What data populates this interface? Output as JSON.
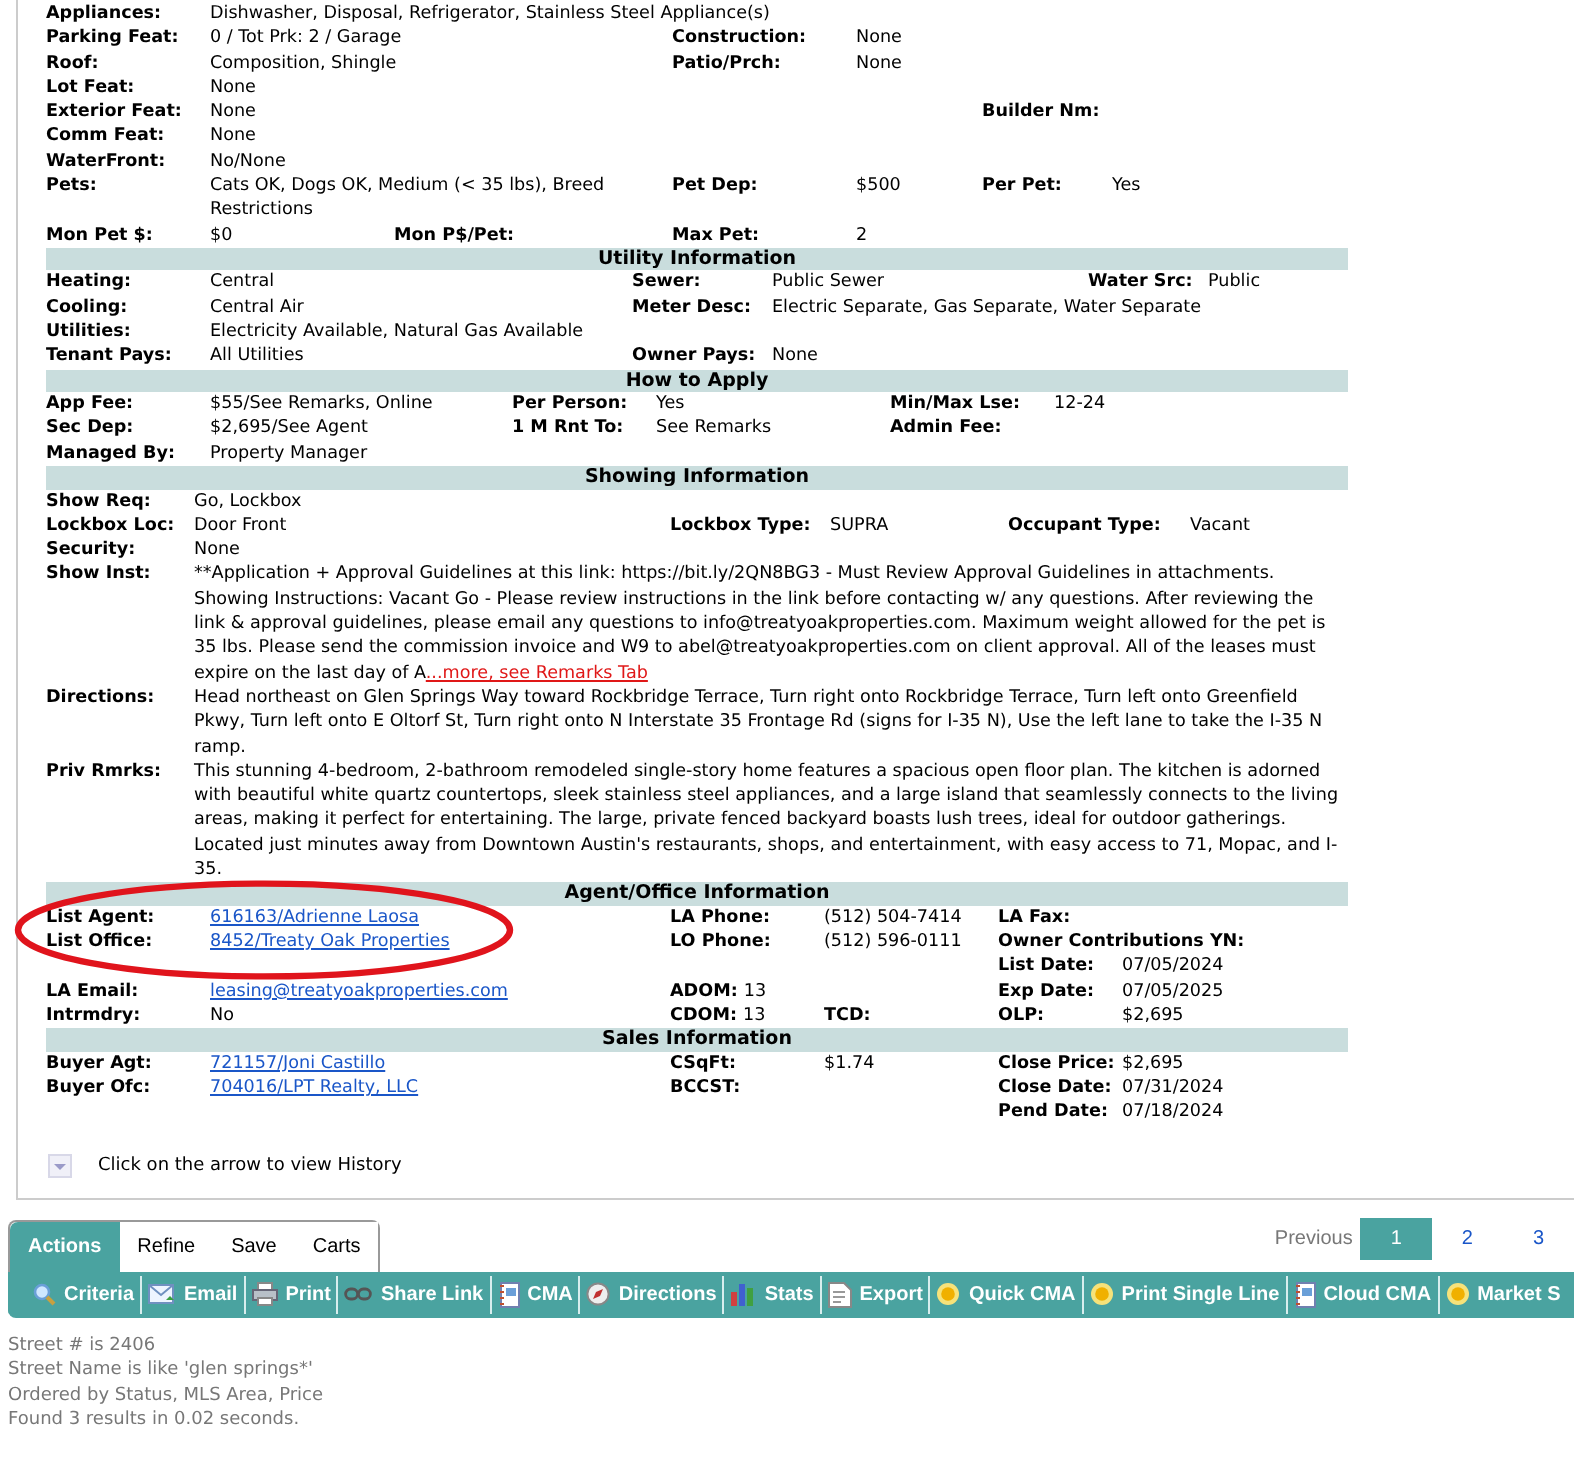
{
  "sections": [
    {
      "rows": [
        [
          {
            "label": "Appliances:",
            "value": "Dishwasher, Disposal, Refrigerator, Stainless Steel Appliance(s)",
            "kind": "text"
          }
        ],
        [
          {
            "label": "Parking Feat:",
            "value": "0 / Tot Prk: 2 / Garage",
            "kind": "text"
          },
          {
            "label": "Construction:",
            "value": "None",
            "kind": "text"
          }
        ],
        [
          {
            "label": "Roof:",
            "value": "Composition, Shingle",
            "kind": "text"
          },
          {
            "label": "Patio/Prch:",
            "value": "None",
            "kind": "text"
          }
        ],
        [
          {
            "label": "Lot Feat:",
            "value": "None",
            "kind": "text"
          }
        ],
        [
          {
            "label": "Exterior Feat:",
            "value": "None",
            "kind": "text"
          },
          "",
          {
            "label": "Builder Nm:",
            "kind": "text"
          }
        ],
        [
          {
            "label": "Comm Feat:",
            "value": "None",
            "kind": "text"
          }
        ],
        [
          {
            "label": "WaterFront:",
            "value": "No/None",
            "kind": "text"
          }
        ],
        [
          {
            "label": "Pets:",
            "value": "Cats OK, Dogs OK, Medium (< 35 lbs), Breed Restrictions",
            "kind": "text"
          },
          {
            "label": "Pet Dep:",
            "value": "$500",
            "kind": "text"
          },
          {
            "label": "Per Pet:",
            "value": "Yes",
            "kind": "text"
          }
        ],
        [
          {
            "label": "Mon Pet $:",
            "value": "$0",
            "extra_label": "Mon P$/Pet:",
            "kind": "text"
          },
          {
            "label": "Max Pet:",
            "value": "2",
            "kind": "text"
          }
        ]
      ]
    },
    {
      "title": "Utility Information",
      "rows": [
        [
          {
            "label": "Heating:",
            "value": "Central",
            "kind": "text"
          },
          {
            "label": "Sewer:",
            "value": "Public Sewer",
            "kind": "text"
          },
          {
            "label": "Water Src:",
            "value": "Public",
            "kind": "text"
          }
        ],
        [
          {
            "label": "Cooling:",
            "value": "Central Air",
            "kind": "text"
          },
          {
            "label": "Meter Desc:",
            "value": "Electric Separate, Gas Separate, Water Separate",
            "kind": "text"
          }
        ],
        [
          {
            "label": "Utilities:",
            "value": "Electricity Available, Natural Gas Available",
            "kind": "text"
          }
        ],
        [
          {
            "label": "Tenant Pays:",
            "value": "All Utilities",
            "kind": "text"
          },
          {
            "label": "Owner Pays:",
            "value": "None",
            "kind": "text"
          }
        ]
      ]
    },
    {
      "title": "How to Apply",
      "rows": [
        [
          {
            "label": "App Fee:",
            "value": "$55/See Remarks, Online",
            "kind": "text"
          },
          {
            "label": "Per Person:",
            "value": "Yes",
            "kind": "text"
          },
          {
            "label": "Min/Max Lse:",
            "value": "12-24",
            "kind": "text"
          }
        ],
        [
          {
            "label": "Sec Dep:",
            "value": "$2,695/See Agent",
            "kind": "text"
          },
          {
            "label": "1 M Rnt To:",
            "value": "See Remarks",
            "kind": "text"
          },
          {
            "label": "Admin Fee:",
            "kind": "text"
          }
        ],
        [
          {
            "label": "Managed By:",
            "value": "Property Manager",
            "kind": "text"
          }
        ]
      ]
    },
    {
      "title": "Showing Information",
      "rows": [
        [
          {
            "label": "Show Req:",
            "value": "Go, Lockbox",
            "kind": "text"
          }
        ],
        [
          {
            "label": "Lockbox Loc:",
            "value": "Door Front",
            "kind": "text"
          },
          {
            "label": "Lockbox Type:",
            "value": "SUPRA",
            "kind": "text"
          },
          {
            "label": "Occupant Type:",
            "value": "Vacant",
            "kind": "text"
          }
        ],
        [
          {
            "label": "Security:",
            "value": "None",
            "kind": "text"
          }
        ],
        [
          {
            "label": "Show Inst:",
            "value": "**Application + Approval Guidelines at this link: https://bit.ly/2QN8BG3 - Must Review Approval Guidelines in attachments. Showing Instructions: Vacant Go - Please review instructions in the link before contacting w/ any questions. After reviewing the link & approval guidelines, please email any questions to info@treatyoakproperties.com. Maximum weight allowed for the pet is 35 lbs. Please send the commission invoice and W9 to abel@treatyoakproperties.com on client approval. All of the leases must expire on the last day of A",
            "more_link": "...more, see Remarks Tab",
            "kind": "text"
          }
        ],
        [
          {
            "label": "Directions:",
            "value": "Head northeast on Glen Springs Way toward Rockbridge Terrace, Turn right onto Rockbridge Terrace, Turn left onto Greenfield Pkwy, Turn left onto E Oltorf St, Turn right onto N Interstate 35 Frontage Rd (signs for I-35 N), Use the left lane to take the I-35 N ramp.",
            "kind": "text"
          }
        ],
        [
          {
            "label": "Priv Rmrks:",
            "value": "This stunning 4-bedroom, 2-bathroom remodeled single-story home features a spacious open floor plan. The kitchen is adorned with beautiful white quartz countertops, sleek stainless steel appliances, and a large island that seamlessly connects to the living areas, making it perfect for entertaining. The large, private fenced backyard boasts lush trees, ideal for outdoor gatherings. Located just minutes away from Downtown Austin's restaurants, shops, and entertainment, with easy access to 71, Mopac, and I-35.",
            "kind": "text"
          }
        ]
      ]
    },
    {
      "title": "Agent/Office Information",
      "rows": [
        [
          {
            "label": "List Agent:",
            "value": "616163/Adrienne Laosa",
            "kind": "link"
          },
          {
            "label": "LA Phone:",
            "value": "(512) 504-7414",
            "kind": "text"
          },
          {
            "label": "LA Fax:",
            "kind": "text"
          }
        ],
        [
          {
            "label": "List Office:",
            "value": "8452/Treaty Oak Properties",
            "kind": "link"
          },
          {
            "label": "LO Phone:",
            "value": "(512) 596-0111",
            "kind": "text"
          },
          {
            "label": "Owner Contributions YN:",
            "kind": "text"
          }
        ],
        [
          "",
          "",
          {
            "label": "List Date:",
            "value": "07/05/2024",
            "kind": "text"
          }
        ],
        [
          {
            "label": "LA Email:",
            "value": "leasing@treatyoakproperties.com",
            "kind": "link"
          },
          {
            "label": "ADOM:",
            "value": "13",
            "kind": "inline"
          },
          {
            "label": "Exp Date:",
            "value": "07/05/2025",
            "kind": "text"
          }
        ],
        [
          {
            "label": "Intrmdry:",
            "value": "No",
            "kind": "text"
          },
          {
            "label": "CDOM:",
            "value": "13",
            "extra_label": "TCD:",
            "kind": "inline"
          },
          {
            "label": "OLP:",
            "value": "$2,695",
            "kind": "text"
          }
        ]
      ]
    },
    {
      "title": "Sales Information",
      "rows": [
        [
          {
            "label": "Buyer Agt:",
            "value": "721157/Joni Castillo",
            "kind": "link"
          },
          {
            "label": "CSqFt:",
            "value": "$1.74",
            "kind": "text"
          },
          {
            "label": "Close Price:",
            "value": "$2,695",
            "kind": "text"
          }
        ],
        [
          {
            "label": "Buyer Ofc:",
            "value": "704016/LPT Realty, LLC",
            "kind": "link"
          },
          {
            "label": "BCCST:",
            "kind": "text"
          },
          {
            "label": "Close Date:",
            "value": "07/31/2024",
            "kind": "text"
          }
        ],
        [
          "",
          "",
          {
            "label": "Pend Date:",
            "value": "07/18/2024",
            "kind": "text"
          }
        ]
      ]
    }
  ],
  "history": {
    "text": "Click on the arrow to view History"
  },
  "tabs": [
    {
      "label": "Actions",
      "selected": true
    },
    {
      "label": "Refine",
      "selected": false
    },
    {
      "label": "Save",
      "selected": false
    },
    {
      "label": "Carts",
      "selected": false
    }
  ],
  "pagination": {
    "previous": "Previous",
    "pages": [
      {
        "label": "1",
        "selected": true
      },
      {
        "label": "2",
        "selected": false
      },
      {
        "label": "3",
        "selected": false
      }
    ]
  },
  "toolbar": [
    "Criteria",
    "Email",
    "Print",
    "Share Link",
    "CMA",
    "Directions",
    "Stats",
    "Export",
    "Quick CMA",
    "Print Single Line",
    "Cloud CMA",
    "Market S"
  ],
  "criteria": [
    "Street # is 2406",
    "Street Name is like 'glen springs*'",
    "Ordered by Status, MLS Area, Price",
    "Found 3 results in 0.02 seconds."
  ]
}
